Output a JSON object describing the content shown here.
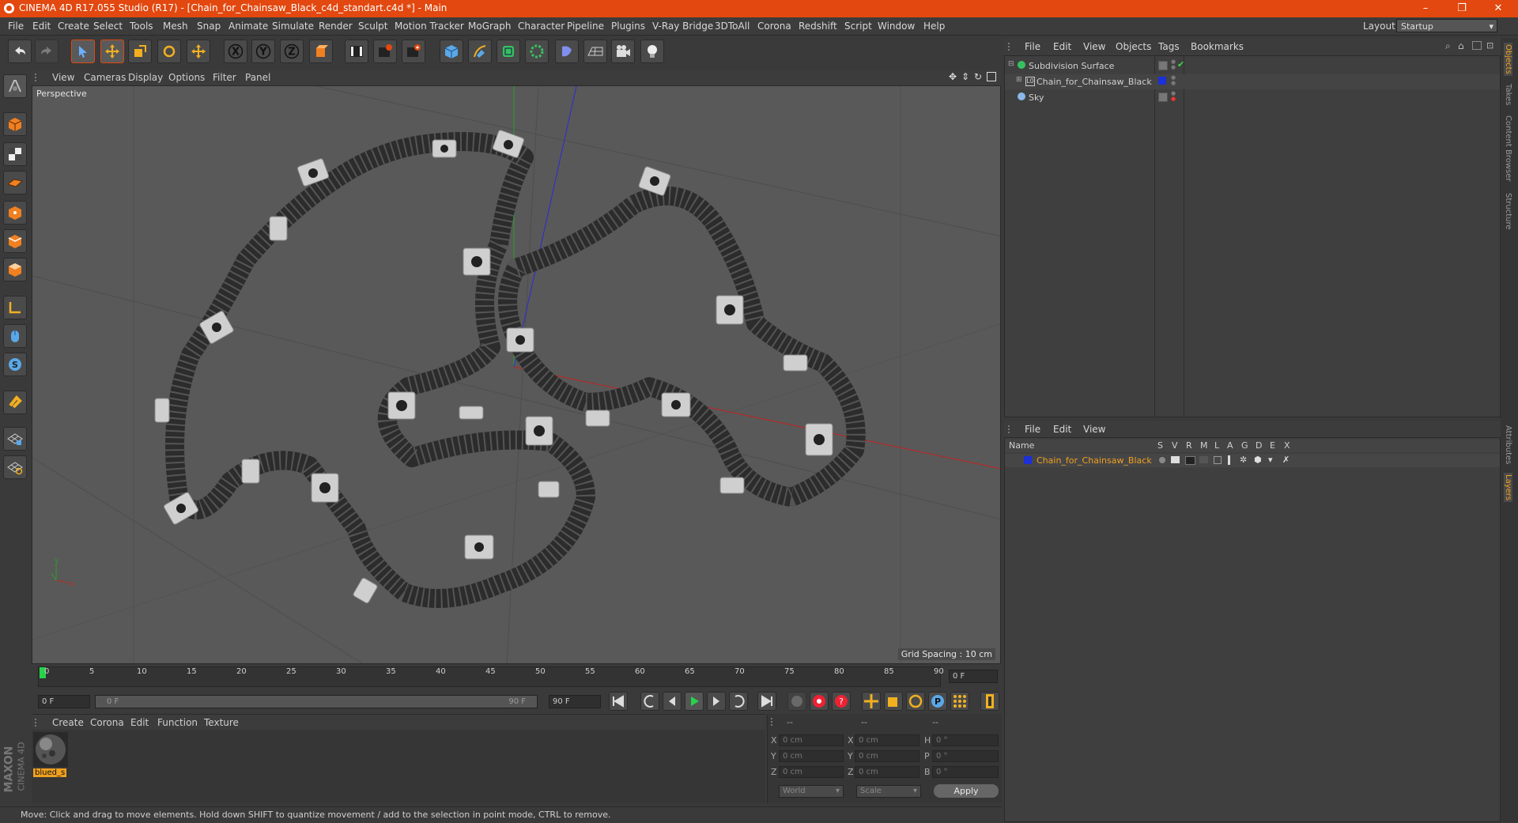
{
  "titlebar": {
    "title": "CINEMA 4D R17.055 Studio (R17) - [Chain_for_Chainsaw_Black_c4d_standart.c4d *] - Main",
    "minimize": "–",
    "maximize": "❐",
    "close": "✕"
  },
  "menubar": {
    "items": [
      "File",
      "Edit",
      "Create",
      "Select",
      "Tools",
      "Mesh",
      "Snap",
      "Animate",
      "Simulate",
      "Render",
      "Sculpt",
      "Motion Tracker",
      "MoGraph",
      "Character",
      "Pipeline",
      "Plugins",
      "V-Ray Bridge",
      "3DToAll",
      "Corona",
      "Redshift",
      "Script",
      "Window",
      "Help"
    ],
    "layout_label": "Layout:",
    "layout_value": "Startup"
  },
  "toolbar": {
    "icons": [
      "undo-icon",
      "redo-icon",
      "select-arrow-icon",
      "move-icon",
      "scale-icon",
      "rotate-icon",
      "move-last-icon",
      "x-axis-icon",
      "y-axis-icon",
      "z-axis-icon",
      "coordinate-system-icon",
      "render-view-icon",
      "render-picture-viewer-icon",
      "render-settings-icon",
      "cube-icon",
      "pen-icon",
      "subdivision-icon",
      "array-icon",
      "deformer-icon",
      "floor-icon",
      "camera-icon",
      "light-icon"
    ],
    "axis_labels": [
      "X",
      "Y",
      "Z"
    ]
  },
  "viewport": {
    "menu": [
      "View",
      "Cameras",
      "Display",
      "Options",
      "Filter",
      "Panel"
    ],
    "label": "Perspective",
    "grid_spacing": "Grid Spacing : 10 cm",
    "axis_x": "x",
    "axis_y": "y"
  },
  "timeline": {
    "ticks": [
      "0",
      "5",
      "10",
      "15",
      "20",
      "25",
      "30",
      "35",
      "40",
      "45",
      "50",
      "55",
      "60",
      "65",
      "70",
      "75",
      "80",
      "85",
      "90"
    ],
    "current_frame_field": "0 F",
    "start_field": "0 F",
    "range_start": "0 F",
    "range_end": "90 F",
    "end_field": "90 F"
  },
  "materials": {
    "menu": [
      "Create",
      "Corona",
      "Edit",
      "Function",
      "Texture"
    ],
    "items": [
      {
        "name": "blued_s"
      }
    ]
  },
  "coordinates": {
    "headers": [
      "--",
      "--",
      "--"
    ],
    "rows": [
      {
        "l1": "X",
        "v1": "0 cm",
        "l2": "X",
        "v2": "0 cm",
        "l3": "H",
        "v3": "0 °"
      },
      {
        "l1": "Y",
        "v1": "0 cm",
        "l2": "Y",
        "v2": "0 cm",
        "l3": "P",
        "v3": "0 °"
      },
      {
        "l1": "Z",
        "v1": "0 cm",
        "l2": "Z",
        "v2": "0 cm",
        "l3": "B",
        "v3": "0 °"
      }
    ],
    "world": "World",
    "scale": "Scale",
    "apply": "Apply"
  },
  "objects": {
    "menu": [
      "File",
      "Edit",
      "View",
      "Objects",
      "Tags",
      "Bookmarks"
    ],
    "items": [
      {
        "name": "Subdivision Surface"
      },
      {
        "name": "Chain_for_Chainsaw_Black"
      },
      {
        "name": "Sky"
      }
    ]
  },
  "layers": {
    "menu": [
      "File",
      "Edit",
      "View"
    ],
    "header_name": "Name",
    "header_flags": [
      "S",
      "V",
      "R",
      "M",
      "L",
      "A",
      "G",
      "D",
      "E",
      "X"
    ],
    "items": [
      {
        "name": "Chain_for_Chainsaw_Black",
        "color": "#1d2fd6"
      }
    ]
  },
  "sidetabs": [
    "Objects",
    "Takes",
    "Content Browser",
    "Structure",
    "Attributes",
    "Layers"
  ],
  "status": "Move: Click and drag to move elements. Hold down SHIFT to quantize movement / add to the selection in point mode, CTRL to remove.",
  "brand": {
    "line1": "MAXON",
    "line2": "CINEMA 4D"
  },
  "colors": {
    "title_bar": "#e2480f",
    "accent_orange": "#f0a020",
    "layer_blue": "#1d2fd6"
  }
}
